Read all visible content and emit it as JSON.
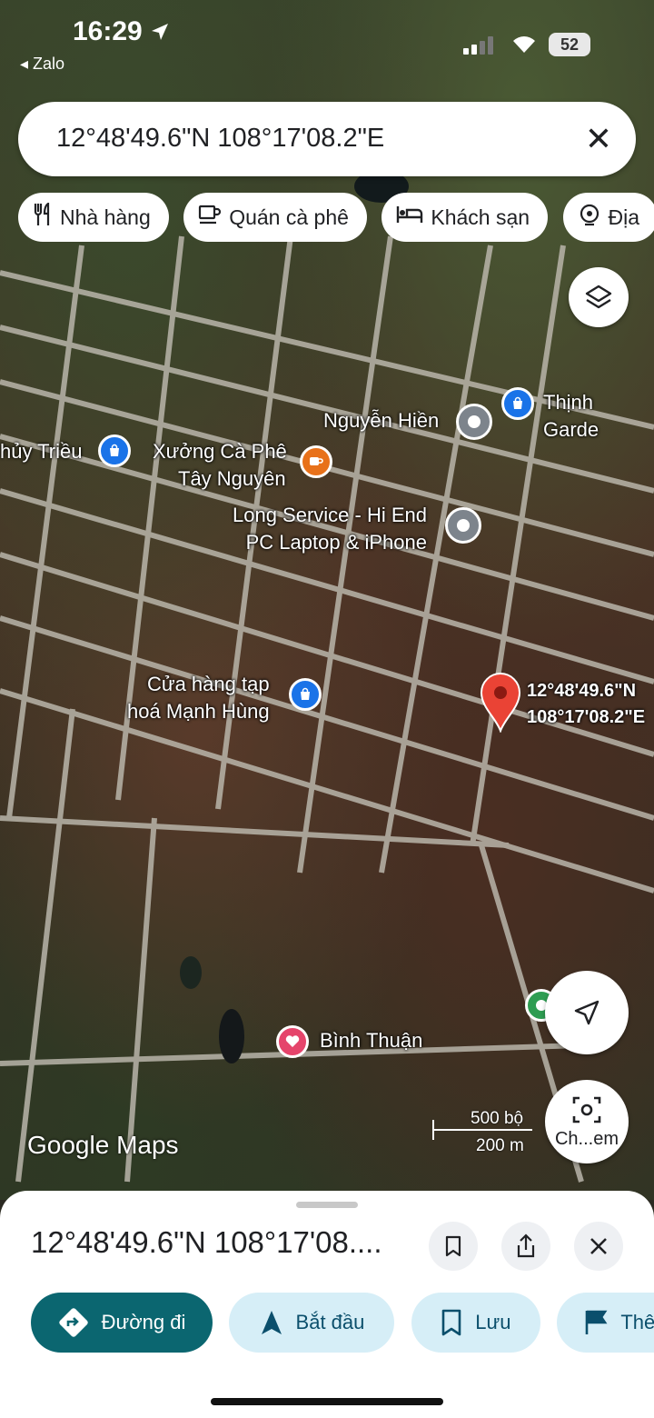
{
  "status": {
    "time": "16:29",
    "back_app": "◂ Zalo",
    "battery": "52"
  },
  "search": {
    "query": "12°48'49.6\"N 108°17'08.2\"E"
  },
  "chips": [
    {
      "label": "Nhà hàng",
      "icon": "restaurant-icon"
    },
    {
      "label": "Quán cà phê",
      "icon": "coffee-icon"
    },
    {
      "label": "Khách sạn",
      "icon": "hotel-icon"
    },
    {
      "label": "Địa",
      "icon": "attraction-icon"
    }
  ],
  "map": {
    "pois": [
      {
        "label": "Thịnh Garde",
        "icon": "shopping-bag-icon"
      },
      {
        "label": "Nguyễn Hiền",
        "icon": "place-icon"
      },
      {
        "label": "hủy Triều",
        "icon": "shopping-bag-icon"
      },
      {
        "label": "Xưởng Cà Phê",
        "label2": "Tây Nguyên",
        "icon": "coffee-icon"
      },
      {
        "label": "Long Service - Hi End",
        "label2": "PC Laptop & iPhone",
        "icon": "place-icon"
      },
      {
        "label": "Cửa hàng tạp",
        "label2": "hoá Mạnh Hùng",
        "icon": "shopping-bag-icon"
      },
      {
        "label": "Bình Thuận",
        "icon": "heart-icon"
      }
    ],
    "pin_label_line1": "12°48'49.6\"N",
    "pin_label_line2": "108°17'08.2\"E",
    "logo": "Google Maps",
    "scale_primary": "500 bộ",
    "scale_secondary": "200 m",
    "lens_label": "Ch...em"
  },
  "sheet": {
    "title": "12°48'49.6\"N 108°17'08....",
    "actions": [
      {
        "label": "Đường đi",
        "icon": "directions-icon"
      },
      {
        "label": "Bắt đầu",
        "icon": "navigation-icon"
      },
      {
        "label": "Lưu",
        "icon": "bookmark-icon"
      },
      {
        "label": "Thên",
        "icon": "flag-icon"
      }
    ]
  }
}
